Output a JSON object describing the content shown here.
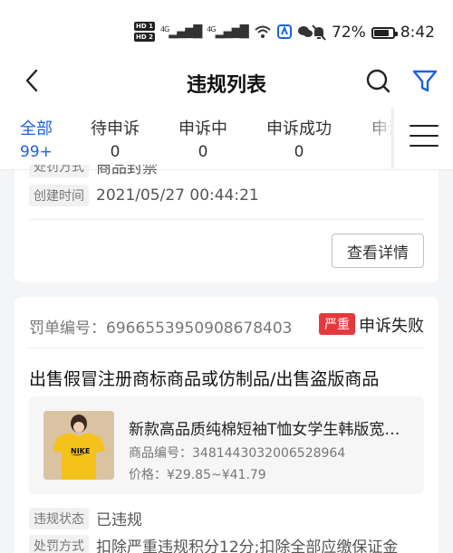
{
  "status_bar": {
    "hd1": "HD 1",
    "hd2": "HD 2",
    "signal1": "4G",
    "signal2": "4G",
    "battery_text": "72%",
    "battery_level": 0.72,
    "time": "8:42"
  },
  "nav": {
    "title": "违规列表"
  },
  "tabs": [
    {
      "label": "全部",
      "count": "99+",
      "active": true
    },
    {
      "label": "待申诉",
      "count": "0",
      "active": false
    },
    {
      "label": "申诉中",
      "count": "0",
      "active": false
    },
    {
      "label": "申诉成功",
      "count": "0",
      "active": false
    },
    {
      "label": "申诉",
      "count": "",
      "active": false
    }
  ],
  "card1": {
    "clipped_label": "处罚方式",
    "clipped_value": "商品封禁",
    "created_label": "创建时间",
    "created_value": "2021/05/27 00:44:21",
    "detail_button": "查看详情"
  },
  "card2": {
    "penalty_label": "罚单编号：",
    "penalty_id": "6966553950908678403",
    "severity": "严重",
    "appeal_status": "申诉失败",
    "violation_title": "出售假冒注册商标商品或仿制品/出售盗版商品",
    "product": {
      "name": "新款高品质纯棉短袖T恤女学生韩版宽松ins上衣",
      "id_label": "商品编号：",
      "id_value": "3481443032006528964",
      "price_label": "价格：",
      "price_value": "¥29.85~¥41.79",
      "thumb_logo": "NIKE"
    },
    "status_label": "违规状态",
    "status_value": "已违规",
    "punish_label": "处罚方式",
    "punish_value": "扣除严重违规积分12分;扣除全部应缴保证金"
  },
  "colors": {
    "accent": "#1c62e0",
    "severity": "#e4393c"
  }
}
